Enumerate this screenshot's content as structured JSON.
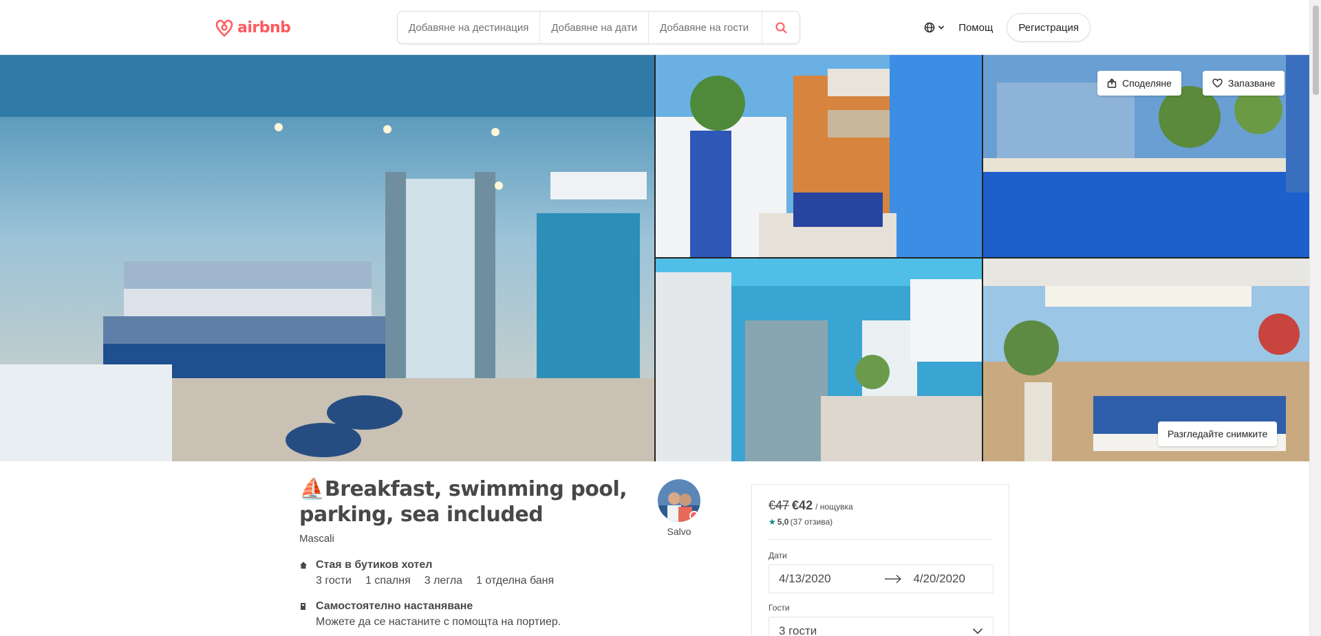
{
  "header": {
    "logo_text": "airbnb",
    "search": {
      "destination_placeholder": "Добавяне на дестинация",
      "dates_placeholder": "Добавяне на дати",
      "guests_placeholder": "Добавяне на гости"
    },
    "help_label": "Помощ",
    "signup_label": "Регистрация"
  },
  "gallery": {
    "share_label": "Споделяне",
    "save_label": "Запазване",
    "show_photos_label": "Разгледайте снимките"
  },
  "listing": {
    "title_emoji": "⛵",
    "title": "Breakfast, swimming pool, parking, sea included",
    "location": "Mascali",
    "host_name": "Salvo",
    "room_type": "Стая в бутиков хотел",
    "details": [
      "3 гости",
      "1 спалня",
      "3 легла",
      "1 отделна баня"
    ],
    "checkin_title": "Самостоятелно настаняване",
    "checkin_desc": "Можете да се настаните с помощта на портиер."
  },
  "booking": {
    "old_price": "€47",
    "new_price": "€42",
    "per_night": "/ нощувка",
    "rating_star": "★",
    "rating_score": "5,0",
    "rating_count": "(37 отзива)",
    "dates_label": "Дати",
    "check_in": "4/13/2020",
    "check_out": "4/20/2020",
    "guests_label": "Гости",
    "guests_value": "3 гости"
  },
  "colors": {
    "brand": "#ff5a5f",
    "rating": "#008489",
    "text": "#484848"
  },
  "icons": {
    "logo": "airbnb-logo-icon",
    "search": "search-icon",
    "globe": "globe-icon",
    "chevron": "chevron-down-icon",
    "share": "share-icon",
    "heart": "heart-icon",
    "home": "home-icon",
    "key": "key-icon",
    "arrow": "arrow-right-icon"
  }
}
